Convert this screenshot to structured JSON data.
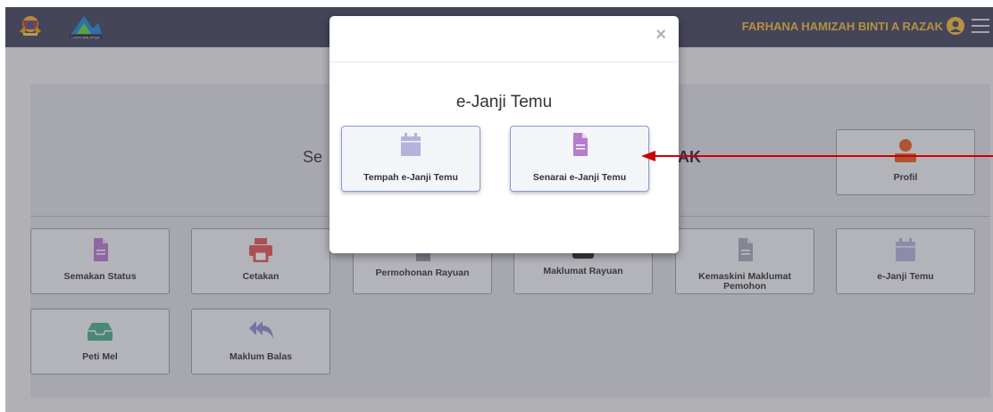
{
  "header": {
    "logo_label": "Jata Negara",
    "brand_logo_label": "LHDN MALAYSIA",
    "user_name": "FARHANA HAMIZAH BINTI A RAZAK"
  },
  "welcome": {
    "prefix": "Se",
    "suffix": "AK"
  },
  "tiles": {
    "profil": "Profil",
    "semakan_status": "Semakan Status",
    "cetakan": "Cetakan",
    "permohonan_rayuan": "Permohonan Rayuan",
    "maklumat_rayuan": "Maklumat Rayuan",
    "kemaskini_maklumat_pemohon": "Kemaskini Maklumat Pemohon",
    "e_janji_temu": "e-Janji Temu",
    "peti_mel": "Peti Mel",
    "maklum_balas": "Maklum Balas"
  },
  "modal": {
    "close_symbol": "×",
    "title": "e-Janji Temu",
    "options": [
      {
        "label": "Tempah e-Janji Temu",
        "icon": "calendar-icon"
      },
      {
        "label": "Senarai e-Janji Temu",
        "icon": "file-icon"
      }
    ]
  },
  "colors": {
    "topbar": "#464660",
    "user_name": "#f0b93a",
    "calendar_icon": "#b3b3db",
    "file_icon_purple": "#b77ccc",
    "printer_icon": "#e25656",
    "profile_icon": "#e95c1f",
    "inbox_icon": "#4fac8a",
    "reply_icon": "#8d8fcd",
    "arrow": "#cc0000"
  }
}
